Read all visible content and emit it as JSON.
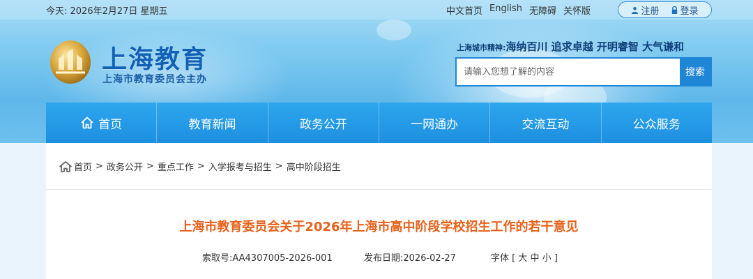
{
  "topbar": {
    "date": "今天: 2026年2月27日 星期五",
    "links": [
      "中文首页",
      "English",
      "无障碍",
      "关怀版"
    ],
    "register": "注册",
    "login": "登录"
  },
  "logo": {
    "title": "上海教育",
    "subtitle": "上海市教育委员会主办"
  },
  "slogan": {
    "prefix": "上海城市精神:",
    "text": "海纳百川 追求卓越 开明睿智 大气谦和"
  },
  "search": {
    "placeholder": "请输入您想了解的内容",
    "button": "搜索"
  },
  "nav": [
    "首页",
    "教育新闻",
    "政务公开",
    "一网通办",
    "交流互动",
    "公众服务"
  ],
  "breadcrumb": [
    "首页",
    "政务公开",
    "重点工作",
    "入学报考与招生",
    "高中阶段招生"
  ],
  "article": {
    "title": "上海市教育委员会关于2026年上海市高中阶段学校招生工作的若干意见",
    "index_label": "索取号:",
    "index_value": "AA4307005-2026-001",
    "date_label": "发布日期:",
    "date_value": "2026-02-27",
    "font_label": "字体",
    "font_sizes": [
      "大",
      "中",
      "小"
    ]
  },
  "colors": {
    "nav_bg": "#1d8fe0",
    "title_orange": "#e8611a",
    "brand_blue": "#1162b6"
  }
}
